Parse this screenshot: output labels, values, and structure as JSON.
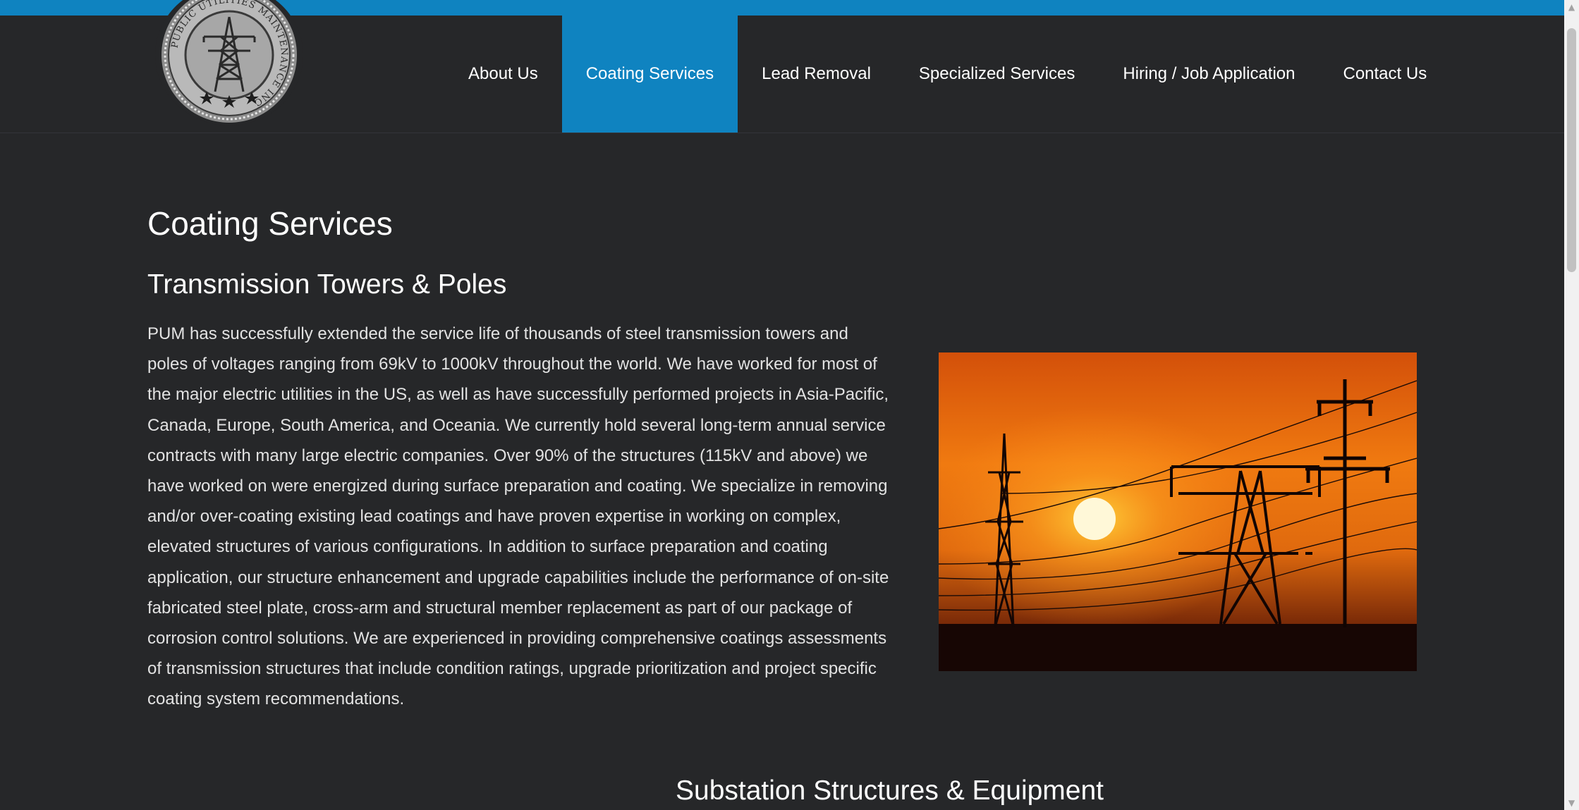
{
  "nav": {
    "items": [
      {
        "label": "About Us",
        "active": false
      },
      {
        "label": "Coating Services",
        "active": true
      },
      {
        "label": "Lead Removal",
        "active": false
      },
      {
        "label": "Specialized Services",
        "active": false
      },
      {
        "label": "Hiring / Job Application",
        "active": false
      },
      {
        "label": "Contact Us",
        "active": false
      }
    ]
  },
  "logo": {
    "text": "PUBLIC UTILITIES MAINTENANCE INC",
    "icon": "transmission-tower-seal-icon"
  },
  "main": {
    "page_title": "Coating Services",
    "section1_title": "Transmission Towers & Poles",
    "section1_body": "PUM has successfully extended the service life of thousands of steel transmission towers and poles of voltages ranging from 69kV to 1000kV throughout the world. We have worked for most of the major electric utilities in the US, as well as have successfully performed projects in Asia-Pacific, Canada, Europe, South America, and Oceania. We currently hold several long-term annual service contracts with many large electric companies. Over 90% of the structures (115kV and above) we have worked on were energized during surface preparation and coating. We specialize in removing and/or over-coating existing lead coatings and have proven expertise in working on complex, elevated structures of various configurations. In addition to surface preparation and coating application, our structure enhancement and upgrade capabilities include the performance of on-site fabricated steel plate, cross-arm and structural member replacement as part of our package of corrosion control solutions. We are experienced in providing comprehensive coatings assessments of transmission structures that include condition ratings, upgrade prioritization and project specific coating system recommendations.",
    "section2_title": "Substation Structures & Equipment"
  },
  "colors": {
    "accent": "#0f83c0",
    "background": "#262729",
    "text": "#ffffff",
    "body_text": "#e2e2e2"
  },
  "scrollbar": {
    "up_icon": "scroll-up-arrow-icon",
    "down_icon": "scroll-down-arrow-icon"
  }
}
